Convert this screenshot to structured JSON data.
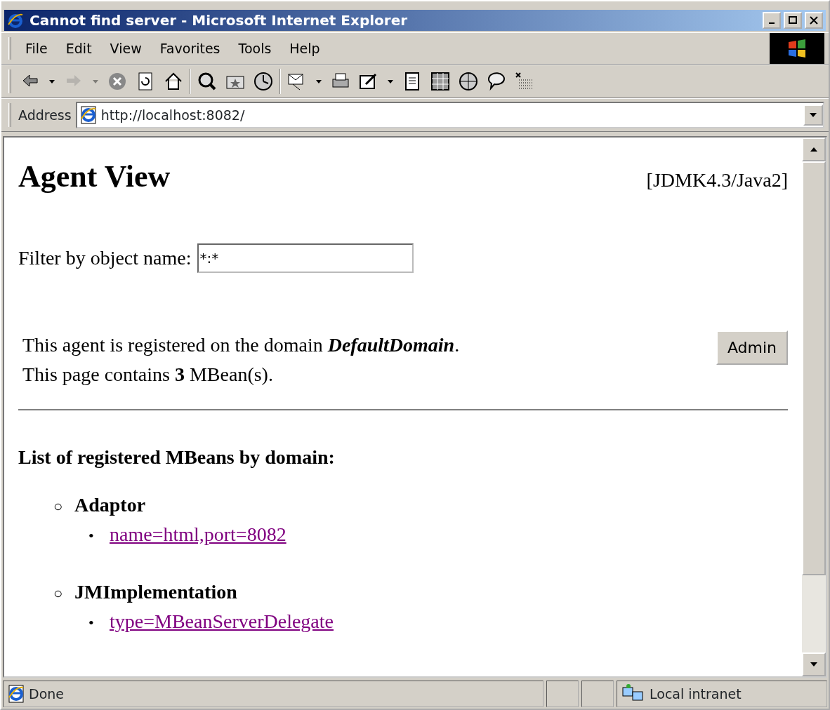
{
  "window": {
    "title": "Cannot find server - Microsoft Internet Explorer"
  },
  "menu": [
    "File",
    "Edit",
    "View",
    "Favorites",
    "Tools",
    "Help"
  ],
  "toolbar": [
    [
      {
        "kind": "back",
        "disabled": false
      },
      {
        "kind": "caret",
        "disabled": false
      },
      {
        "kind": "forward",
        "disabled": true
      },
      {
        "kind": "caret",
        "disabled": true
      },
      {
        "kind": "stop",
        "disabled": false
      },
      {
        "kind": "refresh",
        "disabled": false
      },
      {
        "kind": "home",
        "disabled": false
      }
    ],
    [
      {
        "kind": "search",
        "disabled": false
      },
      {
        "kind": "favorites",
        "disabled": false
      },
      {
        "kind": "history",
        "disabled": false
      }
    ],
    [
      {
        "kind": "mail",
        "disabled": false
      },
      {
        "kind": "caret",
        "disabled": false
      },
      {
        "kind": "print",
        "disabled": false
      },
      {
        "kind": "edit",
        "disabled": false
      },
      {
        "kind": "caret",
        "disabled": false
      },
      {
        "kind": "page",
        "disabled": false
      },
      {
        "kind": "grid",
        "disabled": false
      },
      {
        "kind": "globe",
        "disabled": false
      },
      {
        "kind": "speech",
        "disabled": false
      },
      {
        "kind": "dots",
        "disabled": false
      }
    ]
  ],
  "address": {
    "label": "Address",
    "url": "http://localhost:8082/"
  },
  "page": {
    "title": "Agent View",
    "version": "[JDMK4.3/Java2]",
    "filter": {
      "label": "Filter by object name:",
      "value": "*:*"
    },
    "info": [
      "This agent is registered on the domain *DefaultDomain*.",
      "This page contains **3** MBean(s)."
    ],
    "button": "Admin",
    "list_heading": "List of registered MBeans by domain:",
    "domains": [
      {
        "bullet": "○",
        "name": "Adaptor",
        "mbeans": [
          {
            "bullet": "•",
            "label": "name=html,port=8082",
            "visited": true
          }
        ]
      },
      {
        "bullet": "○",
        "name": "JMImplementation",
        "mbeans": [
          {
            "bullet": "•",
            "label": "type=MBeanServerDelegate",
            "visited": true
          }
        ]
      }
    ]
  },
  "status_bar": {
    "text": "Done",
    "zone": "Local intranet"
  }
}
